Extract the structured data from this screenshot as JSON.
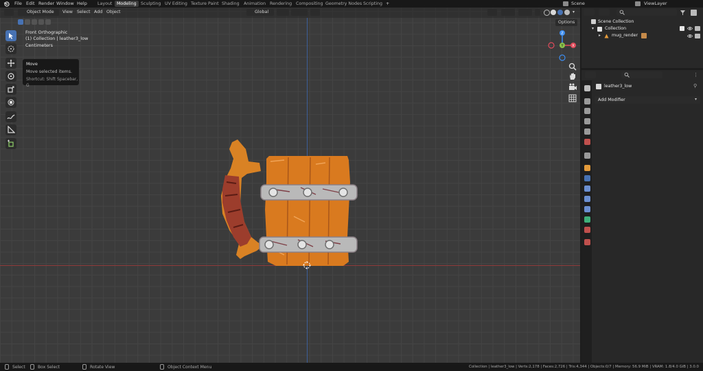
{
  "menu": {
    "items": [
      "File",
      "Edit",
      "Render",
      "Window",
      "Help"
    ]
  },
  "workspaces": {
    "tabs": [
      "Layout",
      "Modeling",
      "Sculpting",
      "UV Editing",
      "Texture Paint",
      "Shading",
      "Animation",
      "Rendering",
      "Compositing",
      "Geometry Nodes",
      "Scripting"
    ],
    "active": "Modeling",
    "add_symbol": "+"
  },
  "scene": {
    "label": "Scene",
    "view_layer": "ViewLayer"
  },
  "viewport_header": {
    "mode": "Object Mode",
    "menus": [
      "View",
      "Select",
      "Add",
      "Object"
    ],
    "orientation": "Global",
    "options_label": "Options"
  },
  "viewport_info": {
    "view_name": "Front Orthographic",
    "collection_line": "(1) Collection | leather3_low",
    "units": "Centimeters"
  },
  "tooltip": {
    "title": "Move",
    "description": "Move selected items.",
    "shortcut": "Shortcut: Shift Spacebar, G"
  },
  "navigation_gizmo": {
    "z": "Z",
    "x": "X",
    "y": "Y"
  },
  "outliner": {
    "root": "Scene Collection",
    "collection": "Collection",
    "object": "mug_render"
  },
  "properties": {
    "object_name": "leather3_low",
    "add_modifier": "Add Modifier"
  },
  "statusbar": {
    "select": "Select",
    "box_select": "Box Select",
    "rotate_view": "Rotate View",
    "context_menu": "Object Context Menu",
    "stats": "Collection | leather3_low | Verts:2,178 | Faces:2,726 | Tris:4,344 | Objects:0/7 | Memory: 56.9 MiB | VRAM: 1.8/4.0 GiB | 3.0.0"
  },
  "colors": {
    "accent": "#4772b3",
    "x_axis": "#e04b5b",
    "y_axis": "#8bc34a",
    "z_axis": "#3d8df0",
    "wood": "#d97a1f",
    "metal_band": "#b9b9b9",
    "leather": "#9c3d2c"
  }
}
